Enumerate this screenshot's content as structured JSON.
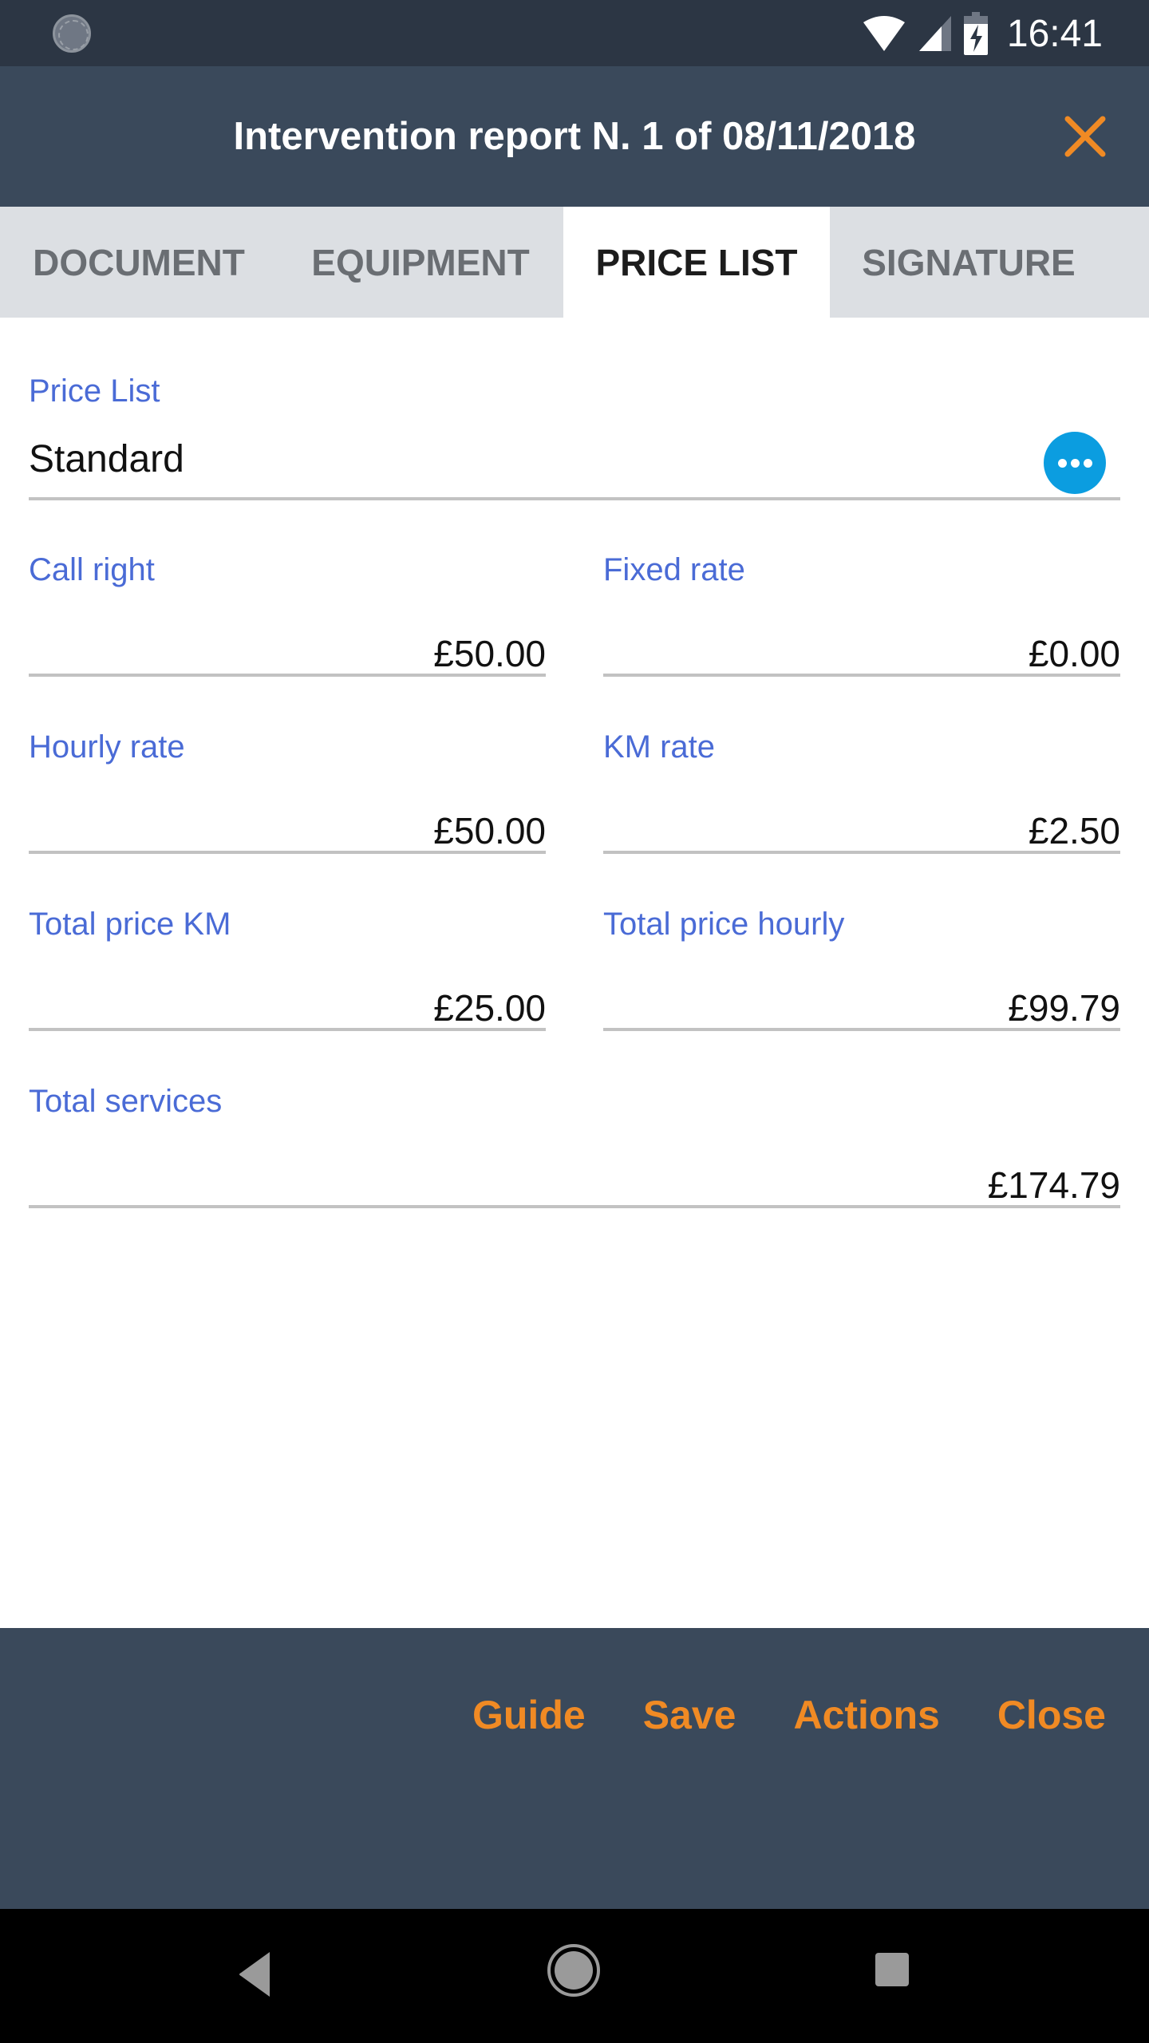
{
  "status_bar": {
    "time": "16:41",
    "icons": [
      "sync-spinner-icon",
      "wifi-icon",
      "signal-icon",
      "battery-charging-icon"
    ]
  },
  "header": {
    "title": "Intervention report N. 1 of 08/11/2018",
    "close_icon": "close-icon",
    "accent_color": "#f08a24"
  },
  "tabs": [
    {
      "label": "DOCUMENT",
      "active": false
    },
    {
      "label": "EQUIPMENT",
      "active": false
    },
    {
      "label": "PRICE LIST",
      "active": true
    },
    {
      "label": "SIGNATURE",
      "active": false
    }
  ],
  "form": {
    "price_list": {
      "label": "Price List",
      "value": "Standard",
      "button_icon": "more-options-icon"
    },
    "fields": [
      {
        "label": "Call right",
        "value": "£50.00"
      },
      {
        "label": "Fixed rate",
        "value": "£0.00"
      },
      {
        "label": "Hourly rate",
        "value": "£50.00"
      },
      {
        "label": "KM rate",
        "value": "£2.50"
      },
      {
        "label": "Total price KM",
        "value": "£25.00"
      },
      {
        "label": "Total price hourly",
        "value": "£99.79"
      }
    ],
    "total_services": {
      "label": "Total services",
      "value": "£174.79"
    }
  },
  "bottom_actions": [
    "Guide",
    "Save",
    "Actions",
    "Close"
  ],
  "nav_bar": [
    "back-icon",
    "home-icon",
    "recents-icon"
  ]
}
